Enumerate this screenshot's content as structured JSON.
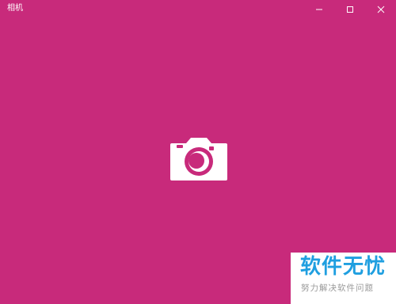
{
  "window": {
    "title": "相机",
    "background_color": "#c82a7b",
    "controls": [
      {
        "name": "minimize-icon"
      },
      {
        "name": "maximize-icon"
      },
      {
        "name": "close-icon"
      }
    ]
  },
  "main": {
    "camera_icon": "camera-icon"
  },
  "watermark": {
    "main": "软件无忧",
    "sub": "努力解决软件问题",
    "main_color": "#1f9fe0",
    "sub_color": "#9a9a9a"
  }
}
